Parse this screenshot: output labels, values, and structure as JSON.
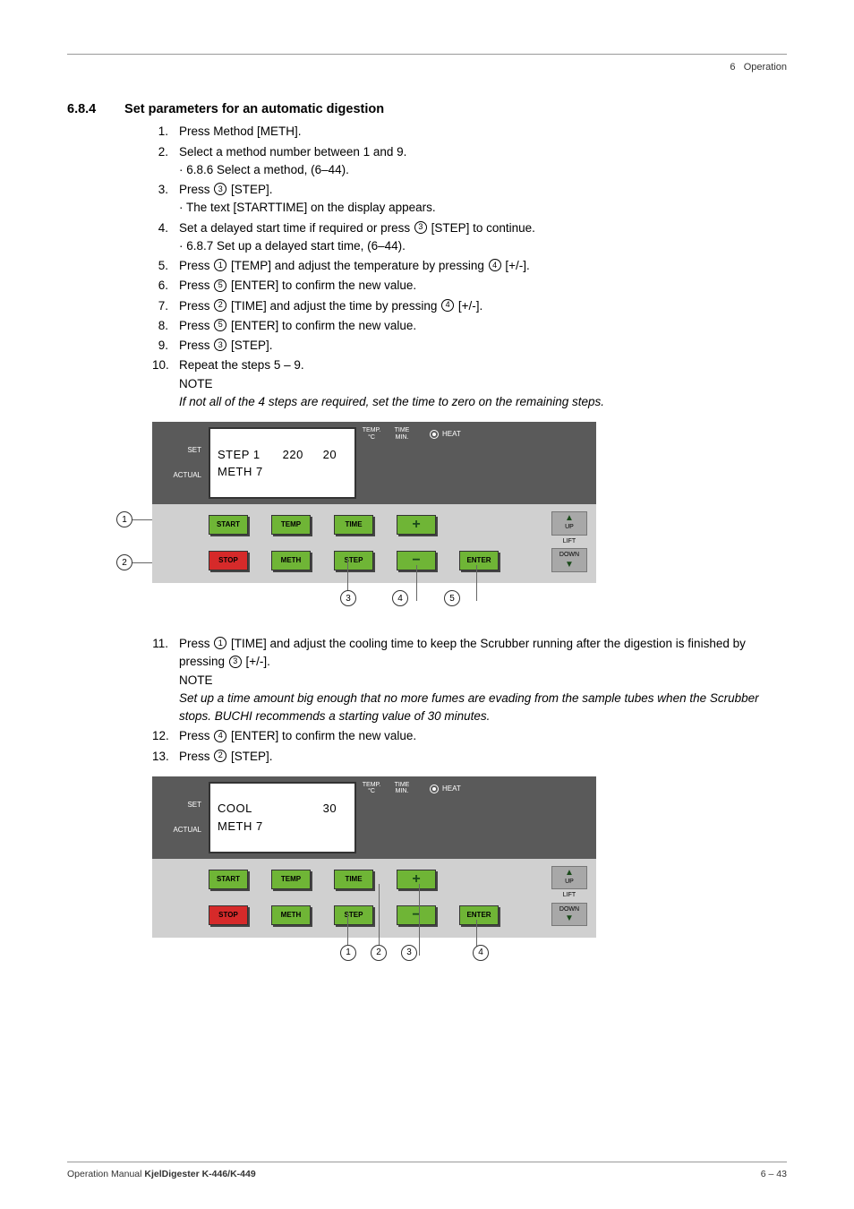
{
  "header": {
    "chapter": "6",
    "title": "Operation"
  },
  "section": {
    "number": "6.8.4",
    "title": "Set parameters for an automatic digestion"
  },
  "steps": [
    {
      "n": "1.",
      "text": "Press Method [METH]."
    },
    {
      "n": "2.",
      "text": "Select a method number between 1 and 9.",
      "sub": "· 6.8.6 Select a method, (6–44)."
    },
    {
      "n": "3.",
      "text_parts": [
        "Press ",
        {
          "c": "3"
        },
        " [STEP]."
      ],
      "sub": "· The text [STARTTIME] on the display appears."
    },
    {
      "n": "4.",
      "text_parts": [
        "Set a delayed start time if required or press ",
        {
          "c": "3"
        },
        " [STEP] to continue."
      ],
      "sub": "· 6.8.7 Set up a delayed start time, (6–44)."
    },
    {
      "n": "5.",
      "text_parts": [
        "Press ",
        {
          "c": "1"
        },
        " [TEMP] and adjust the temperature by pressing ",
        {
          "c": "4"
        },
        " [+/-]."
      ]
    },
    {
      "n": "6.",
      "text_parts": [
        "Press ",
        {
          "c": "5"
        },
        " [ENTER] to confirm the new value."
      ]
    },
    {
      "n": "7.",
      "text_parts": [
        "Press ",
        {
          "c": "2"
        },
        " [TIME] and adjust the time by pressing ",
        {
          "c": "4"
        },
        " [+/-]."
      ]
    },
    {
      "n": "8.",
      "text_parts": [
        "Press ",
        {
          "c": "5"
        },
        " [ENTER] to confirm the new value."
      ]
    },
    {
      "n": "9.",
      "text_parts": [
        "Press ",
        {
          "c": "3"
        },
        " [STEP]."
      ]
    },
    {
      "n": "10.",
      "text": "Repeat the steps 5 – 9.",
      "note_label": "NOTE",
      "note": "If not all of the 4 steps are required, set the time to zero on the remaining steps."
    }
  ],
  "panel1": {
    "set": "SET",
    "actual": "ACTUAL",
    "row1": {
      "label": "STEP 1",
      "temp": "220",
      "time": "20"
    },
    "row2": {
      "label": "METH 7"
    },
    "headers": {
      "temp": "TEMP.\n°C",
      "time": "TIME\nMIN."
    },
    "heat": "HEAT",
    "buttons": {
      "start": "START",
      "temp": "TEMP",
      "time": "TIME",
      "stop": "STOP",
      "meth": "METH",
      "step": "STEP",
      "enter": "ENTER",
      "up": "UP",
      "down": "DOWN",
      "lift": "LIFT"
    },
    "callouts_left": [
      "1",
      "2"
    ],
    "callouts_bottom": [
      "3",
      "4",
      "5"
    ]
  },
  "steps2": [
    {
      "n": "11.",
      "text_parts": [
        "Press ",
        {
          "c": "1"
        },
        " [TIME] and adjust the cooling time to keep the Scrubber running after the digestion is finished by pressing ",
        {
          "c": "3"
        },
        " [+/-]."
      ],
      "note_label": "NOTE",
      "note": "Set up a time amount big enough that no more fumes are evading from the sample tubes when the Scrubber stops. BUCHI recommends a starting value of 30 minutes."
    },
    {
      "n": "12.",
      "text_parts": [
        "Press ",
        {
          "c": "4"
        },
        " [ENTER] to confirm the new value."
      ]
    },
    {
      "n": "13.",
      "text_parts": [
        "Press ",
        {
          "c": "2"
        },
        " [STEP]."
      ]
    }
  ],
  "panel2": {
    "set": "SET",
    "actual": "ACTUAL",
    "row1": {
      "label": "COOL",
      "temp": "",
      "time": "30"
    },
    "row2": {
      "label": "METH 7"
    },
    "headers": {
      "temp": "TEMP.\n°C",
      "time": "TIME\nMIN."
    },
    "heat": "HEAT",
    "buttons": {
      "start": "START",
      "temp": "TEMP",
      "time": "TIME",
      "stop": "STOP",
      "meth": "METH",
      "step": "STEP",
      "enter": "ENTER",
      "up": "UP",
      "down": "DOWN",
      "lift": "LIFT"
    },
    "callouts_bottom": [
      "1",
      "2",
      "3",
      "4"
    ]
  },
  "footer": {
    "left_a": "Operation Manual ",
    "left_b": "KjelDigester K-446/K-449",
    "right": "6 – 43"
  }
}
